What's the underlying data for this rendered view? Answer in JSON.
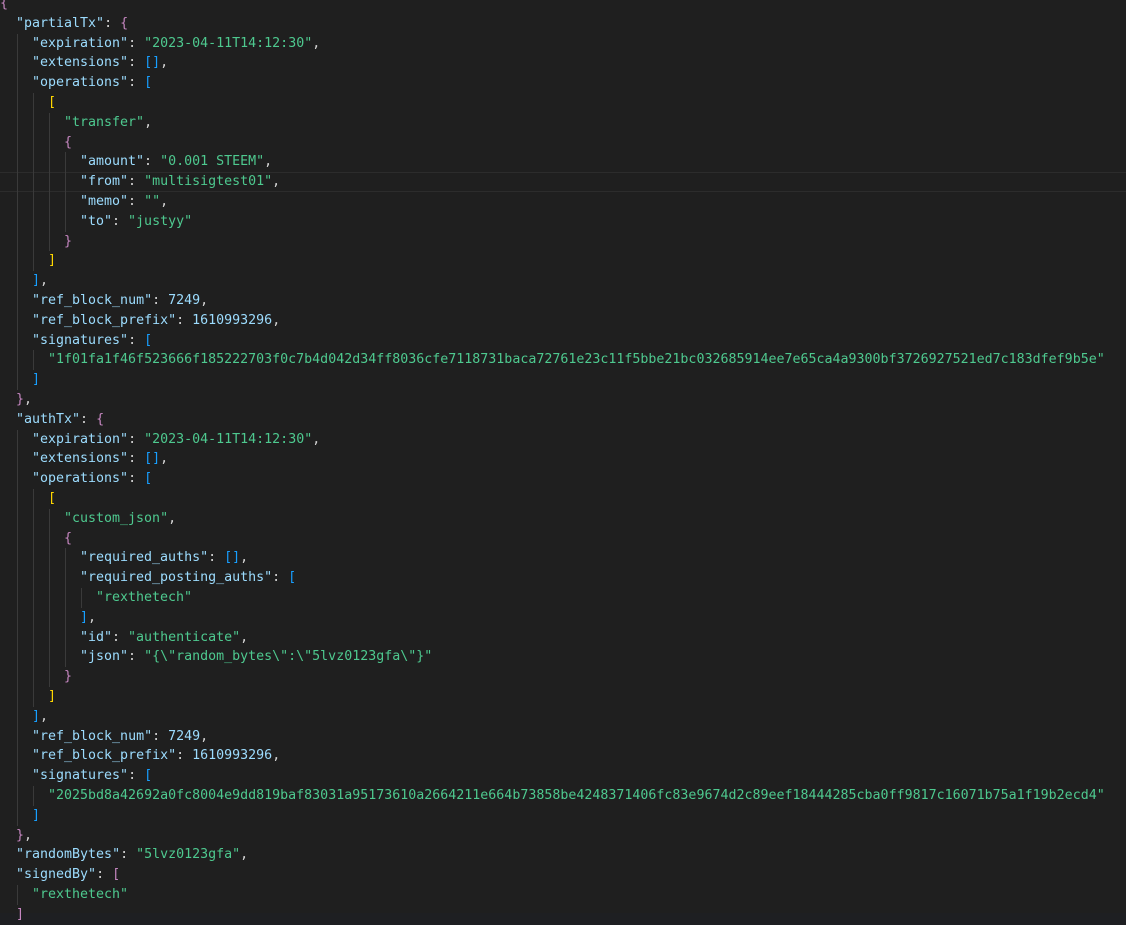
{
  "lines": [
    {
      "i": 0,
      "segs": [
        [
          "b1",
          "{"
        ]
      ]
    },
    {
      "i": 2,
      "segs": [
        [
          "key",
          "\"partialTx\""
        ],
        [
          "p",
          ": "
        ],
        [
          "b1",
          "{"
        ]
      ]
    },
    {
      "i": 4,
      "segs": [
        [
          "key",
          "\"expiration\""
        ],
        [
          "p",
          ": "
        ],
        [
          "sv",
          "\"2023-04-11T14:12:30\""
        ],
        [
          "p",
          ","
        ]
      ]
    },
    {
      "i": 4,
      "segs": [
        [
          "key",
          "\"extensions\""
        ],
        [
          "p",
          ": "
        ],
        [
          "b2",
          "[]"
        ],
        [
          "p",
          ","
        ]
      ]
    },
    {
      "i": 4,
      "segs": [
        [
          "key",
          "\"operations\""
        ],
        [
          "p",
          ": "
        ],
        [
          "b2",
          "["
        ]
      ]
    },
    {
      "i": 6,
      "segs": [
        [
          "b3",
          "["
        ]
      ]
    },
    {
      "i": 8,
      "segs": [
        [
          "sv",
          "\"transfer\""
        ],
        [
          "p",
          ","
        ]
      ]
    },
    {
      "i": 8,
      "segs": [
        [
          "b1",
          "{"
        ]
      ]
    },
    {
      "i": 10,
      "segs": [
        [
          "key",
          "\"amount\""
        ],
        [
          "p",
          ": "
        ],
        [
          "sv",
          "\"0.001 STEEM\""
        ],
        [
          "p",
          ","
        ]
      ]
    },
    {
      "i": 10,
      "segs": [
        [
          "key",
          "\"from\""
        ],
        [
          "p",
          ": "
        ],
        [
          "sv",
          "\"multisigtest01\""
        ],
        [
          "p",
          ","
        ]
      ],
      "current": true
    },
    {
      "i": 10,
      "segs": [
        [
          "key",
          "\"memo\""
        ],
        [
          "p",
          ": "
        ],
        [
          "sv",
          "\"\""
        ],
        [
          "p",
          ","
        ]
      ]
    },
    {
      "i": 10,
      "segs": [
        [
          "key",
          "\"to\""
        ],
        [
          "p",
          ": "
        ],
        [
          "sv",
          "\"justyy\""
        ]
      ]
    },
    {
      "i": 8,
      "segs": [
        [
          "b1",
          "}"
        ]
      ]
    },
    {
      "i": 6,
      "segs": [
        [
          "b3",
          "]"
        ]
      ]
    },
    {
      "i": 4,
      "segs": [
        [
          "b2",
          "]"
        ],
        [
          "p",
          ","
        ]
      ]
    },
    {
      "i": 4,
      "segs": [
        [
          "key",
          "\"ref_block_num\""
        ],
        [
          "p",
          ": "
        ],
        [
          "n",
          "7249"
        ],
        [
          "p",
          ","
        ]
      ]
    },
    {
      "i": 4,
      "segs": [
        [
          "key",
          "\"ref_block_prefix\""
        ],
        [
          "p",
          ": "
        ],
        [
          "n",
          "1610993296"
        ],
        [
          "p",
          ","
        ]
      ]
    },
    {
      "i": 4,
      "segs": [
        [
          "key",
          "\"signatures\""
        ],
        [
          "p",
          ": "
        ],
        [
          "b2",
          "["
        ]
      ]
    },
    {
      "i": 6,
      "segs": [
        [
          "sv",
          "\"1f01fa1f46f523666f185222703f0c7b4d042d34ff8036cfe7118731baca72761e23c11f5bbe21bc032685914ee7e65ca4a9300bf3726927521ed7c183dfef9b5e\""
        ]
      ]
    },
    {
      "i": 4,
      "segs": [
        [
          "b2",
          "]"
        ]
      ]
    },
    {
      "i": 2,
      "segs": [
        [
          "b1",
          "}"
        ],
        [
          "p",
          ","
        ]
      ]
    },
    {
      "i": 2,
      "segs": [
        [
          "key",
          "\"authTx\""
        ],
        [
          "p",
          ": "
        ],
        [
          "b1",
          "{"
        ]
      ]
    },
    {
      "i": 4,
      "segs": [
        [
          "key",
          "\"expiration\""
        ],
        [
          "p",
          ": "
        ],
        [
          "sv",
          "\"2023-04-11T14:12:30\""
        ],
        [
          "p",
          ","
        ]
      ]
    },
    {
      "i": 4,
      "segs": [
        [
          "key",
          "\"extensions\""
        ],
        [
          "p",
          ": "
        ],
        [
          "b2",
          "[]"
        ],
        [
          "p",
          ","
        ]
      ]
    },
    {
      "i": 4,
      "segs": [
        [
          "key",
          "\"operations\""
        ],
        [
          "p",
          ": "
        ],
        [
          "b2",
          "["
        ]
      ]
    },
    {
      "i": 6,
      "segs": [
        [
          "b3",
          "["
        ]
      ]
    },
    {
      "i": 8,
      "segs": [
        [
          "sv",
          "\"custom_json\""
        ],
        [
          "p",
          ","
        ]
      ]
    },
    {
      "i": 8,
      "segs": [
        [
          "b1",
          "{"
        ]
      ]
    },
    {
      "i": 10,
      "segs": [
        [
          "key",
          "\"required_auths\""
        ],
        [
          "p",
          ": "
        ],
        [
          "b2",
          "[]"
        ],
        [
          "p",
          ","
        ]
      ]
    },
    {
      "i": 10,
      "segs": [
        [
          "key",
          "\"required_posting_auths\""
        ],
        [
          "p",
          ": "
        ],
        [
          "b2",
          "["
        ]
      ]
    },
    {
      "i": 12,
      "segs": [
        [
          "sv",
          "\"rexthetech\""
        ]
      ]
    },
    {
      "i": 10,
      "segs": [
        [
          "b2",
          "]"
        ],
        [
          "p",
          ","
        ]
      ]
    },
    {
      "i": 10,
      "segs": [
        [
          "key",
          "\"id\""
        ],
        [
          "p",
          ": "
        ],
        [
          "sv",
          "\"authenticate\""
        ],
        [
          "p",
          ","
        ]
      ]
    },
    {
      "i": 10,
      "segs": [
        [
          "key",
          "\"json\""
        ],
        [
          "p",
          ": "
        ],
        [
          "sv",
          "\"{\\\"random_bytes\\\":\\\"5lvz0123gfa\\\"}\""
        ]
      ]
    },
    {
      "i": 8,
      "segs": [
        [
          "b1",
          "}"
        ]
      ]
    },
    {
      "i": 6,
      "segs": [
        [
          "b3",
          "]"
        ]
      ]
    },
    {
      "i": 4,
      "segs": [
        [
          "b2",
          "]"
        ],
        [
          "p",
          ","
        ]
      ]
    },
    {
      "i": 4,
      "segs": [
        [
          "key",
          "\"ref_block_num\""
        ],
        [
          "p",
          ": "
        ],
        [
          "n",
          "7249"
        ],
        [
          "p",
          ","
        ]
      ]
    },
    {
      "i": 4,
      "segs": [
        [
          "key",
          "\"ref_block_prefix\""
        ],
        [
          "p",
          ": "
        ],
        [
          "n",
          "1610993296"
        ],
        [
          "p",
          ","
        ]
      ]
    },
    {
      "i": 4,
      "segs": [
        [
          "key",
          "\"signatures\""
        ],
        [
          "p",
          ": "
        ],
        [
          "b2",
          "["
        ]
      ]
    },
    {
      "i": 6,
      "segs": [
        [
          "sv",
          "\"2025bd8a42692a0fc8004e9dd819baf83031a95173610a2664211e664b73858be4248371406fc83e9674d2c89eef18444285cba0ff9817c16071b75a1f19b2ecd4\""
        ]
      ]
    },
    {
      "i": 4,
      "segs": [
        [
          "b2",
          "]"
        ]
      ]
    },
    {
      "i": 2,
      "segs": [
        [
          "b1",
          "}"
        ],
        [
          "p",
          ","
        ]
      ]
    },
    {
      "i": 2,
      "segs": [
        [
          "key",
          "\"randomBytes\""
        ],
        [
          "p",
          ": "
        ],
        [
          "sv",
          "\"5lvz0123gfa\""
        ],
        [
          "p",
          ","
        ]
      ]
    },
    {
      "i": 2,
      "segs": [
        [
          "key",
          "\"signedBy\""
        ],
        [
          "p",
          ": "
        ],
        [
          "b1",
          "["
        ]
      ]
    },
    {
      "i": 4,
      "segs": [
        [
          "sv",
          "\"rexthetech\""
        ]
      ]
    },
    {
      "i": 2,
      "segs": [
        [
          "b1",
          "]"
        ]
      ]
    }
  ]
}
